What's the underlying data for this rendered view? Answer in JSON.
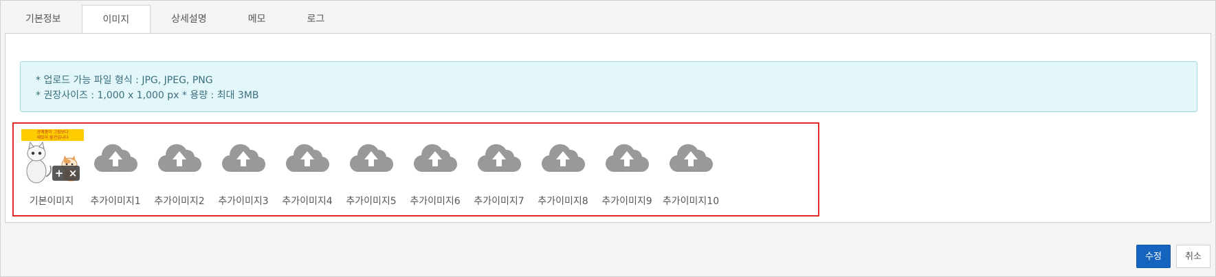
{
  "tabs": [
    {
      "label": "기본정보",
      "active": false
    },
    {
      "label": "이미지",
      "active": true
    },
    {
      "label": "상세설명",
      "active": false
    },
    {
      "label": "메모",
      "active": false
    },
    {
      "label": "로그",
      "active": false
    }
  ],
  "notice": {
    "line1": "* 업로드 가능 파일 형식 : JPG, JPEG, PNG",
    "line2": "* 권장사이즈 : 1,000 x 1,000 px * 용량 : 최대 3MB"
  },
  "main_image": {
    "label": "기본이미지",
    "banner_line1": "공예품이 그림보다",
    "banner_line2": "재밌어 물건입니다",
    "add_symbol": "+",
    "remove_symbol": "×"
  },
  "extra_images": [
    {
      "label": "추가이미지1"
    },
    {
      "label": "추가이미지2"
    },
    {
      "label": "추가이미지3"
    },
    {
      "label": "추가이미지4"
    },
    {
      "label": "추가이미지5"
    },
    {
      "label": "추가이미지6"
    },
    {
      "label": "추가이미지7"
    },
    {
      "label": "추가이미지8"
    },
    {
      "label": "추가이미지9"
    },
    {
      "label": "추가이미지10"
    }
  ],
  "buttons": {
    "save": "수정",
    "cancel": "취소"
  },
  "colors": {
    "accent": "#1565c0",
    "highlight_border": "#e02828",
    "notice_bg": "#e3f7fa",
    "upload_icon": "#999999"
  },
  "icons": {
    "upload": "cloud-upload-icon"
  }
}
